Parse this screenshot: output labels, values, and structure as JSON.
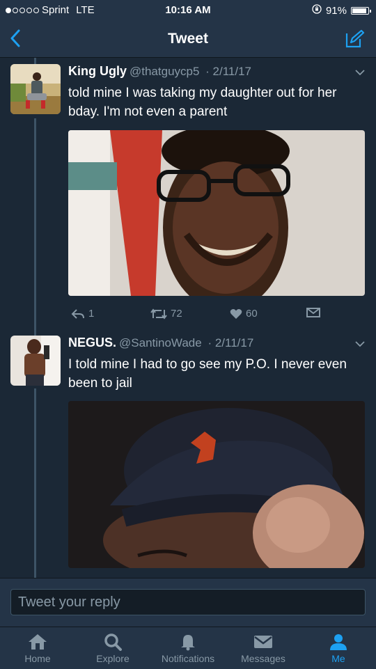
{
  "status": {
    "carrier": "Sprint",
    "network": "LTE",
    "time": "10:16 AM",
    "battery": "91%",
    "battery_level": 0.91
  },
  "nav": {
    "back_icon": "chevron-left-icon",
    "title": "Tweet",
    "compose_icon": "compose-icon"
  },
  "tweets": [
    {
      "name": "King Ugly",
      "handle": "@thatguycp5",
      "date": "· 2/11/17",
      "text": "told mine I was taking my daughter out for her bday. I'm not even a parent",
      "replies": "1",
      "retweets": "72",
      "likes": "60"
    },
    {
      "name": "NEGUS.",
      "handle": "@SantinoWade",
      "date": "· 2/11/17",
      "text": "I told mine I had to go see my P.O. I never even been to jail"
    }
  ],
  "reply": {
    "placeholder": "Tweet your reply"
  },
  "tabs": [
    {
      "label": "Home",
      "icon": "home-icon"
    },
    {
      "label": "Explore",
      "icon": "search-icon"
    },
    {
      "label": "Notifications",
      "icon": "bell-icon"
    },
    {
      "label": "Messages",
      "icon": "envelope-icon"
    },
    {
      "label": "Me",
      "icon": "person-icon",
      "active": true
    }
  ],
  "colors": {
    "background": "#1b2836",
    "bar": "#243447",
    "accent": "#1da1f2",
    "secondary_text": "#8899a6"
  }
}
